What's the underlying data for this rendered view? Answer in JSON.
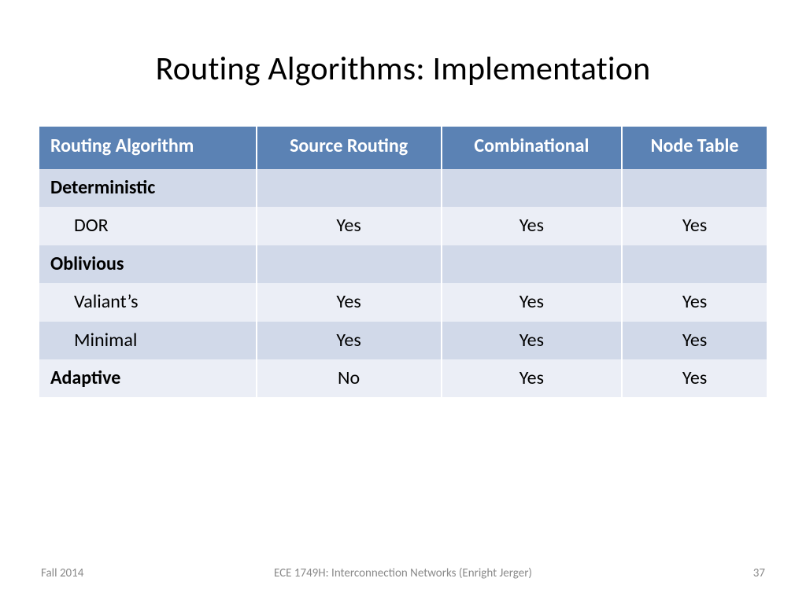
{
  "title": "Routing Algorithms: Implementation",
  "chart_data": {
    "type": "table",
    "columns": [
      "Routing Algorithm",
      "Source Routing",
      "Combinational",
      "Node Table"
    ],
    "rows": [
      {
        "label": "Deterministic",
        "category": true,
        "values": [
          "",
          "",
          ""
        ]
      },
      {
        "label": "DOR",
        "category": false,
        "values": [
          "Yes",
          "Yes",
          "Yes"
        ]
      },
      {
        "label": "Oblivious",
        "category": true,
        "values": [
          "",
          "",
          ""
        ]
      },
      {
        "label": "Valiant’s",
        "category": false,
        "values": [
          "Yes",
          "Yes",
          "Yes"
        ]
      },
      {
        "label": "Minimal",
        "category": false,
        "values": [
          "Yes",
          "Yes",
          "Yes"
        ]
      },
      {
        "label": "Adaptive",
        "category": true,
        "values": [
          "No",
          "Yes",
          "Yes"
        ]
      }
    ]
  },
  "footer": {
    "left": "Fall 2014",
    "center": "ECE 1749H: Interconnection Networks (Enright Jerger)",
    "right": "37"
  }
}
